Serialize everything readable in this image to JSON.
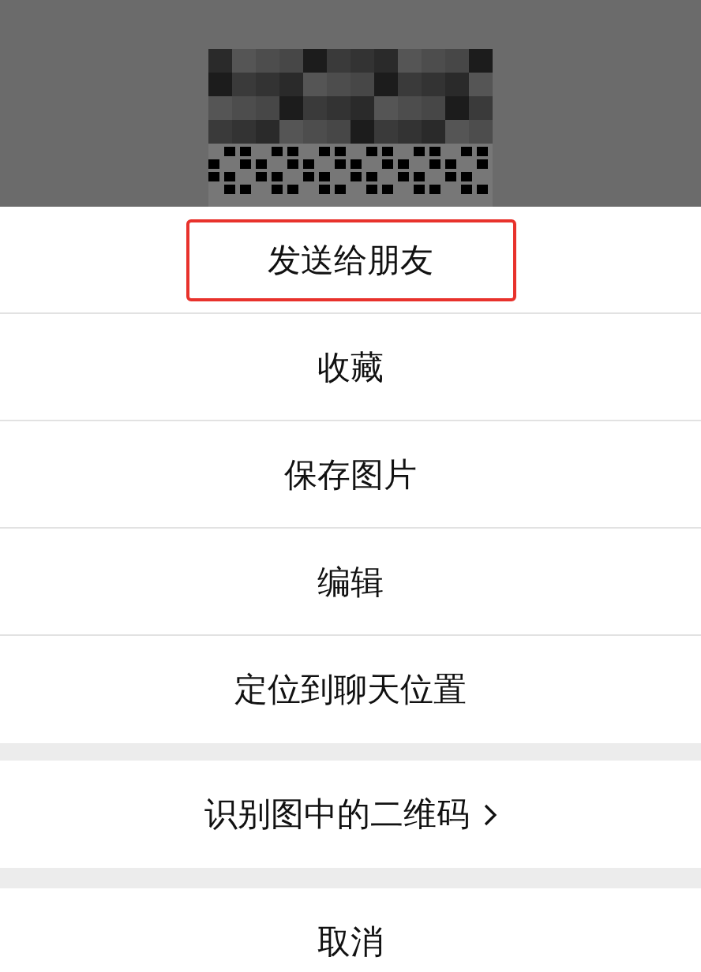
{
  "actions": [
    {
      "label": "发送给朋友",
      "highlighted": true
    },
    {
      "label": "收藏",
      "highlighted": false
    },
    {
      "label": "保存图片",
      "highlighted": false
    },
    {
      "label": "编辑",
      "highlighted": false
    },
    {
      "label": "定位到聊天位置",
      "highlighted": false
    }
  ],
  "qr_action": {
    "label": "识别图中的二维码"
  },
  "cancel": {
    "label": "取消"
  }
}
